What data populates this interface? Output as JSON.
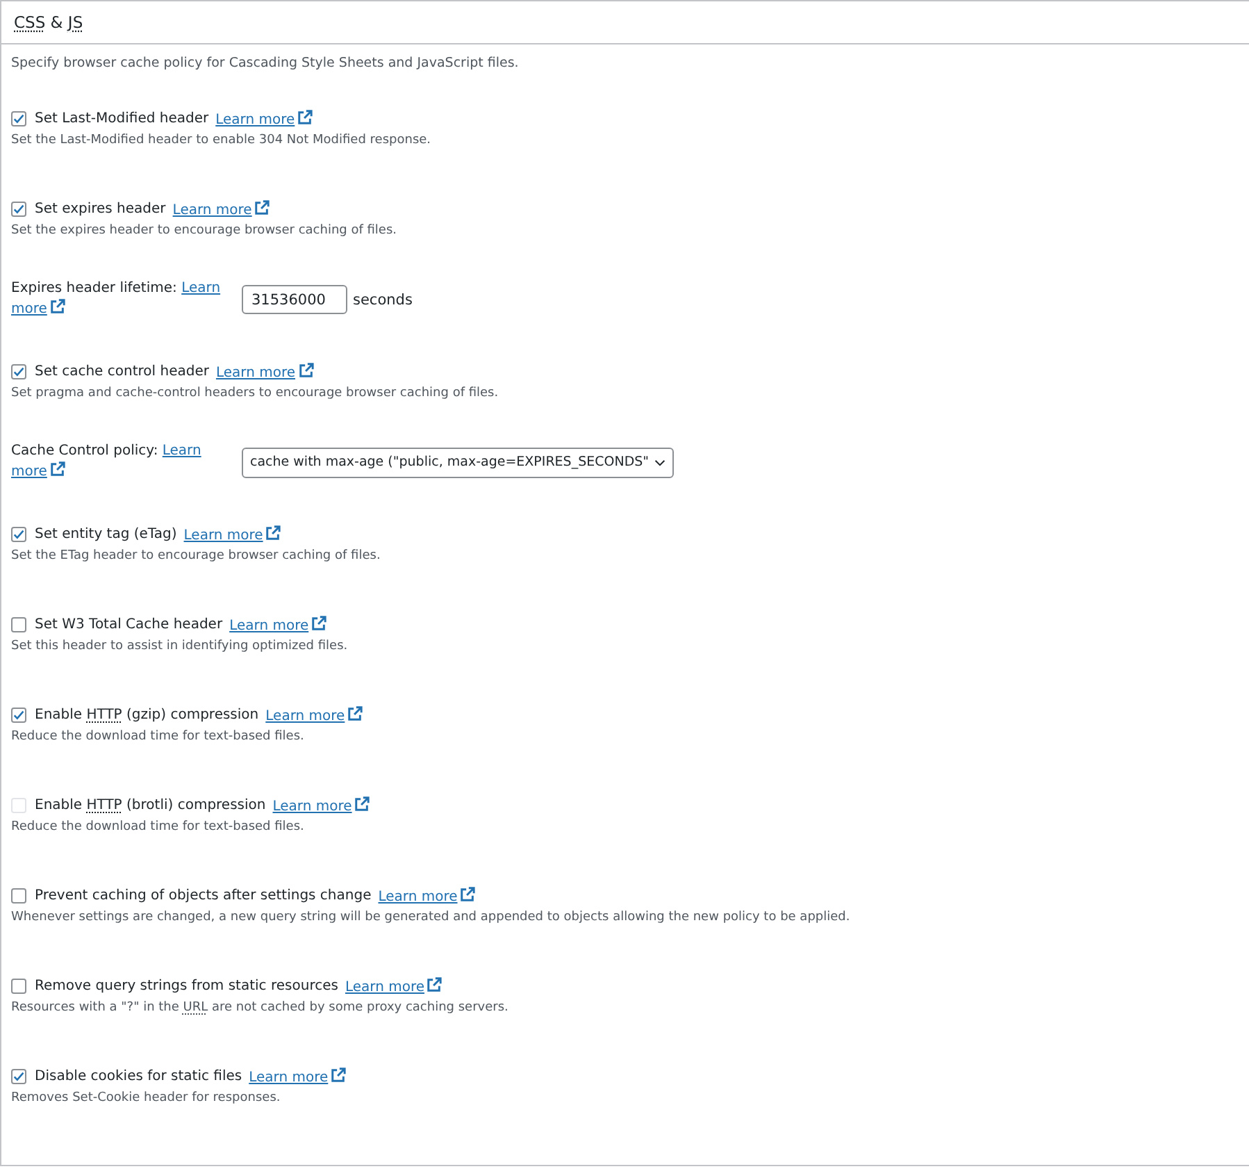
{
  "section": {
    "title": [
      {
        "text": "CSS",
        "abbr": true
      },
      {
        "text": " & "
      },
      {
        "text": "JS",
        "abbr": true
      }
    ],
    "intro": "Specify browser cache policy for Cascading Style Sheets and JavaScript files.",
    "items": [
      {
        "kind": "checkbox",
        "checked": true,
        "disabled": false,
        "label": [
          {
            "text": "Set Last-Modified header"
          }
        ],
        "link": "Learn more",
        "description": "Set the Last-Modified header to enable 304 Not Modified response."
      },
      {
        "kind": "checkbox",
        "checked": true,
        "disabled": false,
        "label": [
          {
            "text": "Set expires header"
          }
        ],
        "link": "Learn more",
        "description": "Set the expires header to encourage browser caching of files."
      },
      {
        "kind": "text",
        "label": "Expires header lifetime:",
        "link_first": "Learn",
        "link_rest": "more",
        "value": "31536000",
        "unit": "seconds"
      },
      {
        "kind": "checkbox",
        "checked": true,
        "disabled": false,
        "label": [
          {
            "text": "Set cache control header"
          }
        ],
        "link": "Learn more",
        "description": "Set pragma and cache-control headers to encourage browser caching of files."
      },
      {
        "kind": "select",
        "label": "Cache Control policy:",
        "link_first": "Learn",
        "link_rest": "more",
        "value": "cache with max-age (\"public, max-age=EXPIRES_SECONDS\""
      },
      {
        "kind": "checkbox",
        "checked": true,
        "disabled": false,
        "label": [
          {
            "text": "Set entity tag (eTag)"
          }
        ],
        "link": "Learn more",
        "description": "Set the ETag header to encourage browser caching of files."
      },
      {
        "kind": "checkbox",
        "checked": false,
        "disabled": false,
        "label": [
          {
            "text": "Set W3 Total Cache header"
          }
        ],
        "link": "Learn more",
        "description": "Set this header to assist in identifying optimized files."
      },
      {
        "kind": "checkbox",
        "checked": true,
        "disabled": false,
        "label": [
          {
            "text": "Enable "
          },
          {
            "text": "HTTP",
            "abbr": true
          },
          {
            "text": " (gzip) compression"
          }
        ],
        "link": "Learn more",
        "description": [
          {
            "text": "Reduce the download time for text-based files."
          }
        ]
      },
      {
        "kind": "checkbox",
        "checked": false,
        "disabled": true,
        "label": [
          {
            "text": "Enable "
          },
          {
            "text": "HTTP",
            "abbr": true
          },
          {
            "text": " (brotli) compression"
          }
        ],
        "link": "Learn more",
        "description": [
          {
            "text": "Reduce the download time for text-based files."
          }
        ]
      },
      {
        "kind": "checkbox",
        "checked": false,
        "disabled": false,
        "label": [
          {
            "text": "Prevent caching of objects after settings change"
          }
        ],
        "link": "Learn more",
        "description": "Whenever settings are changed, a new query string will be generated and appended to objects allowing the new policy to be applied."
      },
      {
        "kind": "checkbox",
        "checked": false,
        "disabled": false,
        "label": [
          {
            "text": "Remove query strings from static resources"
          }
        ],
        "link": "Learn more",
        "description": [
          {
            "text": "Resources with a \"?\" in the "
          },
          {
            "text": "URL",
            "abbr": true
          },
          {
            "text": " are not cached by some proxy caching servers."
          }
        ]
      },
      {
        "kind": "checkbox",
        "checked": true,
        "disabled": false,
        "label": [
          {
            "text": "Disable cookies for static files"
          }
        ],
        "link": "Learn more",
        "description": "Removes Set-Cookie header for responses."
      }
    ]
  }
}
